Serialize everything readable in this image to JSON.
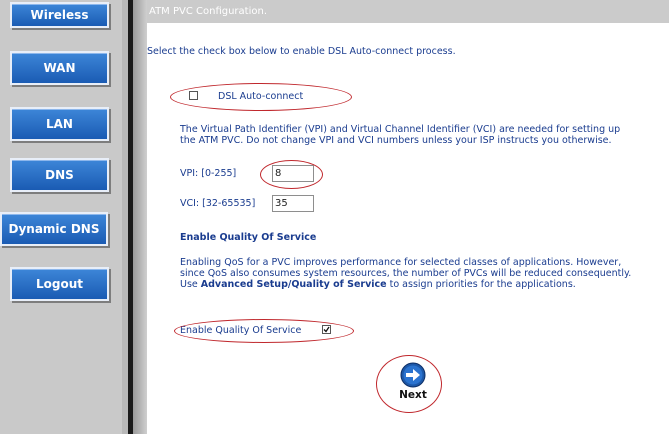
{
  "sidebar": {
    "items": [
      {
        "label": "Wireless"
      },
      {
        "label": "WAN"
      },
      {
        "label": "LAN"
      },
      {
        "label": "DNS"
      },
      {
        "label": "Dynamic DNS"
      },
      {
        "label": "Logout"
      }
    ]
  },
  "page": {
    "title": "ATM PVC Configuration.",
    "intro": "Select the check box below to enable DSL Auto-connect process.",
    "dsl_auto_connect_label": "DSL Auto-connect",
    "vpi_vci_description": "The Virtual Path Identifier (VPI) and Virtual Channel Identifier (VCI) are needed for setting up the ATM PVC. Do not change VPI and VCI numbers unless your ISP instructs you otherwise.",
    "vpi_label": "VPI: [0-255]",
    "vpi_value": "8",
    "vci_label": "VCI: [32-65535]",
    "vci_value": "35",
    "qos_heading": "Enable Quality Of Service",
    "qos_description_1": "Enabling QoS for a PVC improves performance for selected classes of applications. However, since QoS also consumes system resources, the number of PVCs will be reduced consequently. Use ",
    "qos_description_link": "Advanced Setup/Quality of Service",
    "qos_description_2": " to assign priorities for the applications.",
    "qos_checkbox_label": "Enable Quality Of Service",
    "next_label": "Next"
  },
  "state": {
    "dsl_auto_connect_checked": false,
    "qos_checked": true
  },
  "colors": {
    "nav_button": "#1f62bb",
    "text": "#1a3c8f",
    "highlight_ellipse": "#c0282d",
    "title_bar": "#cbcbcb"
  }
}
